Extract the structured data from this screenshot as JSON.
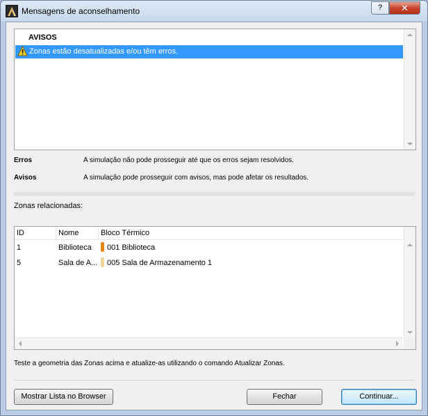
{
  "window": {
    "title": "Mensagens de aconselhamento",
    "help_label": "?",
    "close_label": "✕"
  },
  "warnings": {
    "header": "AVISOS",
    "items": [
      {
        "text": "Zonas estão desatualizadas e/ou têm erros.",
        "icon": "warning-icon"
      }
    ]
  },
  "legend": [
    {
      "term": "Erros",
      "desc": "A simulação não pode prosseguir até que os erros sejam resolvidos."
    },
    {
      "term": "Avisos",
      "desc": "A simulação pode prosseguir com avisos, mas pode afetar os resultados."
    }
  ],
  "zones": {
    "label": "Zonas relacionadas:",
    "columns": [
      "ID",
      "Nome",
      "Bloco Térmico"
    ],
    "rows": [
      {
        "id": "1",
        "name": "Biblioteca",
        "block": "001 Biblioteca",
        "color": "#e8870e"
      },
      {
        "id": "5",
        "name": "Sala de A...",
        "block": "005 Sala de Armazenamento 1",
        "color": "#eed59a"
      }
    ]
  },
  "hint": "Teste a geometria das Zonas acima e atualize-as utilizando o comando Atualizar Zonas.",
  "buttons": {
    "browser": "Mostrar Lista no Browser",
    "close": "Fechar",
    "continue": "Continuar..."
  },
  "colors": {
    "selection": "#3399ff",
    "titlebar": "#c7d8ec",
    "close_button": "#c7442c"
  }
}
